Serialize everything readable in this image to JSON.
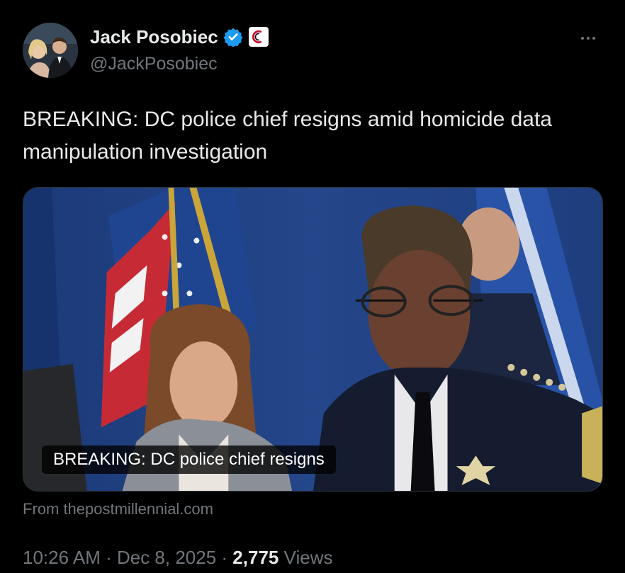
{
  "author": {
    "display_name": "Jack Posobiec",
    "handle": "@JackPosobiec",
    "avatar_icon": "avatar-photo",
    "verified_icon": "verified-badge-icon",
    "affiliation_icon": "affiliate-badge-icon",
    "verified_color": "#1d9bf0"
  },
  "tweet": {
    "text": "BREAKING: DC police chief resigns amid homicide data manipulation investigation"
  },
  "media": {
    "caption": "BREAKING: DC police chief resigns",
    "source": "From thepostmillennial.com"
  },
  "meta": {
    "time": "10:26 AM",
    "separator": " · ",
    "date": "Dec 8, 2025",
    "views_count": "2,775",
    "views_label": " Views"
  },
  "colors": {
    "background": "#000000",
    "text_primary": "#e7e9ea",
    "text_secondary": "#71767b"
  }
}
